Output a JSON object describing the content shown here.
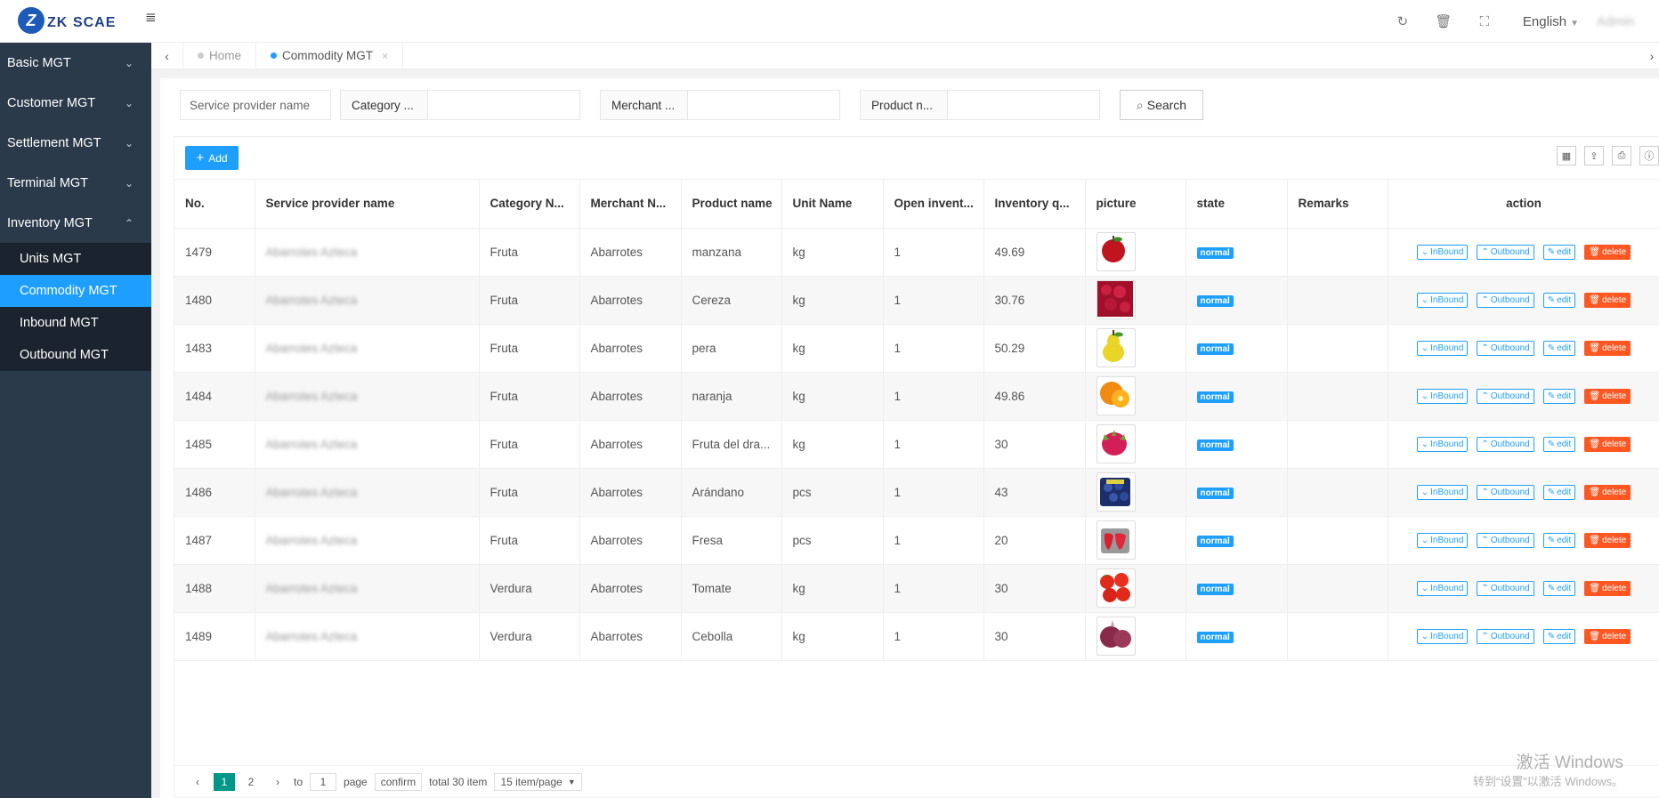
{
  "app": {
    "logo_mark": "Z",
    "logo_text": "ZK",
    "logo_sub": "SCAE"
  },
  "topbar": {
    "menu_icon": "≣",
    "language": "English",
    "user": "Admin"
  },
  "sidebar": {
    "items": [
      {
        "label": "Basic MGT",
        "chev": "⌄"
      },
      {
        "label": "Customer MGT",
        "chev": "⌄"
      },
      {
        "label": "Settlement MGT",
        "chev": "⌄"
      },
      {
        "label": "Terminal MGT",
        "chev": "⌄"
      },
      {
        "label": "Inventory MGT",
        "chev": "⌃"
      }
    ],
    "subitems": [
      {
        "label": "Units MGT"
      },
      {
        "label": "Commodity MGT"
      },
      {
        "label": "Inbound MGT"
      },
      {
        "label": "Outbound MGT"
      }
    ]
  },
  "tabs": [
    {
      "label": "Home"
    },
    {
      "label": "Commodity MGT",
      "close": "×"
    }
  ],
  "search": {
    "provider_placeholder": "Service provider name",
    "category_label": "Category ...",
    "merchant_label": "Merchant ...",
    "product_label": "Product n...",
    "search_label": "Search"
  },
  "toolbar": {
    "add_label": "Add"
  },
  "table": {
    "headers": [
      "No.",
      "Service provider name",
      "Category N...",
      "Merchant N...",
      "Product name",
      "Unit Name",
      "Open invent...",
      "Inventory q...",
      "picture",
      "state",
      "Remarks",
      "action"
    ],
    "rows": [
      {
        "no": "1479",
        "provider": "Abarrotes Azteca",
        "category": "Fruta",
        "merchant": "Abarrotes",
        "product": "manzana",
        "unit": "kg",
        "open": "1",
        "qty": "49.69",
        "pic": "apple",
        "state": "normal",
        "remarks": ""
      },
      {
        "no": "1480",
        "provider": "Abarrotes Azteca",
        "category": "Fruta",
        "merchant": "Abarrotes",
        "product": "Cereza",
        "unit": "kg",
        "open": "1",
        "qty": "30.76",
        "pic": "cherry",
        "state": "normal",
        "remarks": ""
      },
      {
        "no": "1483",
        "provider": "Abarrotes Azteca",
        "category": "Fruta",
        "merchant": "Abarrotes",
        "product": "pera",
        "unit": "kg",
        "open": "1",
        "qty": "50.29",
        "pic": "pear",
        "state": "normal",
        "remarks": ""
      },
      {
        "no": "1484",
        "provider": "Abarrotes Azteca",
        "category": "Fruta",
        "merchant": "Abarrotes",
        "product": "naranja",
        "unit": "kg",
        "open": "1",
        "qty": "49.86",
        "pic": "orange",
        "state": "normal",
        "remarks": ""
      },
      {
        "no": "1485",
        "provider": "Abarrotes Azteca",
        "category": "Fruta",
        "merchant": "Abarrotes",
        "product": "Fruta del dra...",
        "unit": "kg",
        "open": "1",
        "qty": "30",
        "pic": "dragonfruit",
        "state": "normal",
        "remarks": ""
      },
      {
        "no": "1486",
        "provider": "Abarrotes Azteca",
        "category": "Fruta",
        "merchant": "Abarrotes",
        "product": "Arándano",
        "unit": "pcs",
        "open": "1",
        "qty": "43",
        "pic": "blueberry",
        "state": "normal",
        "remarks": ""
      },
      {
        "no": "1487",
        "provider": "Abarrotes Azteca",
        "category": "Fruta",
        "merchant": "Abarrotes",
        "product": "Fresa",
        "unit": "pcs",
        "open": "1",
        "qty": "20",
        "pic": "strawberry",
        "state": "normal",
        "remarks": ""
      },
      {
        "no": "1488",
        "provider": "Abarrotes Azteca",
        "category": "Verdura",
        "merchant": "Abarrotes",
        "product": "Tomate",
        "unit": "kg",
        "open": "1",
        "qty": "30",
        "pic": "tomato",
        "state": "normal",
        "remarks": ""
      },
      {
        "no": "1489",
        "provider": "Abarrotes Azteca",
        "category": "Verdura",
        "merchant": "Abarrotes",
        "product": "Cebolla",
        "unit": "kg",
        "open": "1",
        "qty": "30",
        "pic": "onion",
        "state": "normal",
        "remarks": ""
      }
    ],
    "actions": {
      "inbound": "InBound",
      "outbound": "Outbound",
      "edit": "edit",
      "delete": "delete"
    }
  },
  "pager": {
    "current": "1",
    "page2": "2",
    "to": "to",
    "page_input": "1",
    "page_word": "page",
    "confirm": "confirm",
    "total": "total 30 item",
    "per_page": "15 item/page"
  },
  "watermark": {
    "line1": "激活 Windows",
    "line2": "转到“设置”以激活 Windows。"
  },
  "colors": {
    "accent": "#1e9fff",
    "sidebar": "#2b3a4a",
    "delete": "#ff5722",
    "pager_current": "#009688"
  }
}
